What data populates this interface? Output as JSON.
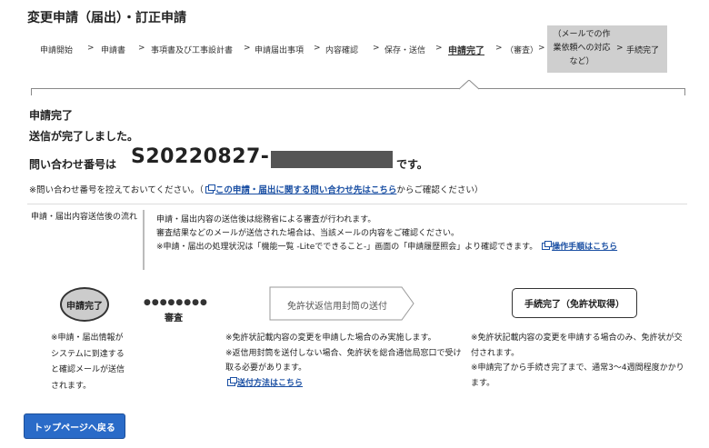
{
  "page": {
    "title": "変更申請（届出）・訂正申請"
  },
  "breadcrumb": {
    "steps": [
      "申請開始",
      "申請書",
      "事項書及び工事設計書",
      "申請届出事項",
      "内容確認",
      "保存・送信",
      "申請完了",
      "（審査）",
      "（メールでの作業依頼への対応など）",
      "手続完了"
    ],
    "separator": ">",
    "current_index": 6
  },
  "completion": {
    "heading": "申請完了",
    "sent_message": "送信が完了しました。",
    "inquiry_label": "問い合わせ番号は",
    "inquiry_number": "S20220827-",
    "inquiry_suffix": "です。",
    "note_prefix": "※問い合わせ番号を控えておいてください。（",
    "note_link": "この申請・届出に関する問い合わせ先はこちら",
    "note_suffix": "からご確認ください）"
  },
  "flow": {
    "label": "申請・届出内容送信後の流れ",
    "line1": "申請・届出内容の送信後は総務省による審査が行われます。",
    "line2": "審査結果などのメールが送信された場合は、当該メールの内容をご確認ください。",
    "line3": "※申請・届出の処理状況は「機能一覧 -Liteでできること-」画面の「申請履歴照会」より確認できます。",
    "link": "操作手順はこちら"
  },
  "diagram": {
    "done_label": "申請完了",
    "dots": "●●●●●●●●",
    "review_label": "審査",
    "return_envelope_label": "免許状返信用封筒の送付",
    "procedure_done_label": "手続完了（免許状取得）",
    "col1": "※申請・届出情報がシステムに到達すると確認メールが送信されます。",
    "col2_line1": "※免許状記載内容の変更を申請した場合のみ実施します。",
    "col2_line2": "※返信用封筒を送付しない場合、免許状を総合通信局窓口で受け取る必要があります。",
    "col2_link": "送付方法はこちら",
    "col3_line1": "※免許状記載内容の変更を申請する場合のみ、免許状が交付されます。",
    "col3_line2": "※申請完了から手続き完了まで、通常3〜4週間程度かかります。"
  },
  "footer": {
    "top_button": "トップページへ戻る"
  },
  "colors": {
    "link": "#1a4fa3",
    "button": "#2a6bc8",
    "stepper_highlight": "#cfcfcf"
  }
}
